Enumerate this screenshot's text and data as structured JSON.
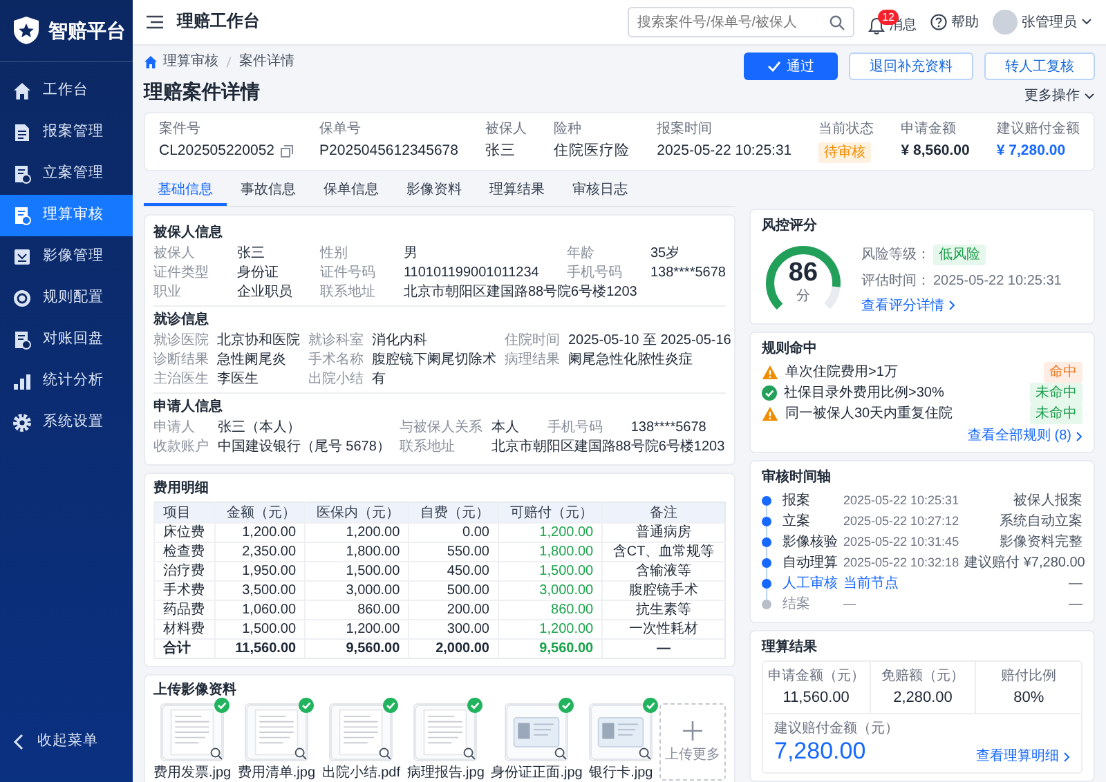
{
  "sidebar": {
    "logo": "智赔平台",
    "items": [
      {
        "label": "工作台",
        "selected": false
      },
      {
        "label": "报案管理",
        "selected": false
      },
      {
        "label": "立案管理",
        "selected": false
      },
      {
        "label": "理算审核",
        "selected": true
      },
      {
        "label": "影像管理",
        "selected": false
      },
      {
        "label": "规则配置",
        "selected": false
      },
      {
        "label": "对账回盘",
        "selected": false
      },
      {
        "label": "统计分析",
        "selected": false
      },
      {
        "label": "系统设置",
        "selected": false
      }
    ],
    "collapse": "收起菜单"
  },
  "topbar": {
    "title": "理赔工作台",
    "search": {
      "placeholder": "搜索案件号/保单号/被保人"
    },
    "notifications": {
      "label": "消息",
      "badge": "12"
    },
    "help": "帮助",
    "user": "张管理员"
  },
  "breadcrumb": [
    "理算审核",
    "案件详情"
  ],
  "page_title": "理赔案件详情",
  "actions": [
    {
      "label": "通过",
      "kind": "primary"
    },
    {
      "label": "退回补充资料",
      "kind": "default"
    },
    {
      "label": "转人工复核",
      "kind": "default"
    }
  ],
  "more_actions": "更多操作",
  "summary": [
    {
      "label": "案件号",
      "value": "CL202505220052",
      "kind": "copyable"
    },
    {
      "label": "保单号",
      "value": "P2025045612345678",
      "kind": "text"
    },
    {
      "label": "被保人",
      "value": "张三",
      "kind": "text"
    },
    {
      "label": "险种",
      "value": "住院医疗险",
      "kind": "text"
    },
    {
      "label": "报案时间",
      "value": "2025-05-22 10:25:31",
      "kind": "text"
    },
    {
      "label": "当前状态",
      "value": "待审核",
      "kind": "status"
    },
    {
      "label": "申请金额",
      "value": "¥ 8,560.00",
      "kind": "amount"
    },
    {
      "label": "建议赔付金额",
      "value": "¥ 7,280.00",
      "kind": "highlight"
    }
  ],
  "tabs": [
    {
      "label": "基础信息",
      "selected": true
    },
    {
      "label": "事故信息",
      "selected": false
    },
    {
      "label": "保单信息",
      "selected": false
    },
    {
      "label": "影像资料",
      "selected": false
    },
    {
      "label": "理算结果",
      "selected": false
    },
    {
      "label": "审核日志",
      "selected": false
    }
  ],
  "info_sections": [
    {
      "title": "被保人信息",
      "rows": [
        [
          {
            "label": "被保人",
            "value": "张三"
          },
          {
            "label": "性别",
            "value": "男"
          },
          {
            "label": "年龄",
            "value": "35岁"
          }
        ],
        [
          {
            "label": "证件类型",
            "value": "身份证"
          },
          {
            "label": "证件号码",
            "value": "110101199001011234"
          },
          {
            "label": "手机号码",
            "value": "138****5678"
          }
        ],
        [
          {
            "label": "职业",
            "value": "企业职员"
          },
          {
            "label": "联系地址",
            "value": "北京市朝阳区建国路88号院6号楼1203"
          }
        ]
      ]
    },
    {
      "title": "就诊信息",
      "rows": [
        [
          {
            "label": "就诊医院",
            "value": "北京协和医院"
          },
          {
            "label": "就诊科室",
            "value": "消化内科"
          },
          {
            "label": "住院时间",
            "value": "2025-05-10 至 2025-05-16"
          }
        ],
        [
          {
            "label": "诊断结果",
            "value": "急性阑尾炎"
          },
          {
            "label": "手术名称",
            "value": "腹腔镜下阑尾切除术"
          },
          {
            "label": "病理结果",
            "value": "阑尾急性化脓性炎症"
          }
        ],
        [
          {
            "label": "主治医生",
            "value": "李医生"
          },
          {
            "label": "出院小结",
            "value": "有"
          }
        ]
      ]
    },
    {
      "title": "申请人信息",
      "rows": [
        [
          {
            "label": "申请人",
            "value": "张三（本人）"
          },
          {
            "label": "与被保人关系",
            "value": "本人"
          },
          {
            "label": "手机号码",
            "value": "138****5678"
          }
        ],
        [
          {
            "label": "收款账户",
            "value": "中国建设银行（尾号 5678）"
          },
          {
            "label": "联系地址",
            "value": "北京市朝阳区建国路88号院6号楼1203"
          }
        ]
      ]
    }
  ],
  "expenses": {
    "title": "费用明细",
    "columns": [
      "项目",
      "金额（元）",
      "医保内（元）",
      "自费（元）",
      "可赔付（元）",
      "备注"
    ],
    "rows": [
      {
        "kind": "item",
        "cells": [
          "床位费",
          "1,200.00",
          "1,200.00",
          "0.00",
          "1,200.00",
          "普通病房"
        ]
      },
      {
        "kind": "item",
        "cells": [
          "检查费",
          "2,350.00",
          "1,800.00",
          "550.00",
          "1,800.00",
          "含CT、血常规等"
        ]
      },
      {
        "kind": "item",
        "cells": [
          "治疗费",
          "1,950.00",
          "1,500.00",
          "450.00",
          "1,500.00",
          "含输液等"
        ]
      },
      {
        "kind": "item",
        "cells": [
          "手术费",
          "3,500.00",
          "3,000.00",
          "500.00",
          "3,000.00",
          "腹腔镜手术"
        ]
      },
      {
        "kind": "item",
        "cells": [
          "药品费",
          "1,060.00",
          "860.00",
          "200.00",
          "860.00",
          "抗生素等"
        ]
      },
      {
        "kind": "item",
        "cells": [
          "材料费",
          "1,500.00",
          "1,200.00",
          "300.00",
          "1,200.00",
          "一次性耗材"
        ]
      },
      {
        "kind": "total",
        "cells": [
          "合计",
          "11,560.00",
          "9,560.00",
          "2,000.00",
          "9,560.00",
          "—"
        ]
      }
    ]
  },
  "uploads": {
    "title": "上传影像资料",
    "files": [
      {
        "name": "费用发票.jpg",
        "kind": "document",
        "verified": true
      },
      {
        "name": "费用清单.jpg",
        "kind": "document",
        "verified": true
      },
      {
        "name": "出院小结.pdf",
        "kind": "document",
        "verified": true
      },
      {
        "name": "病理报告.jpg",
        "kind": "document",
        "verified": true
      },
      {
        "name": "身份证正面.jpg",
        "kind": "card",
        "verified": true
      },
      {
        "name": "银行卡.jpg",
        "kind": "card",
        "verified": true
      }
    ],
    "add": "上传更多"
  },
  "risk": {
    "title": "风控评分",
    "score": "86",
    "unit": "分",
    "level": 0.86,
    "risk_label": "风险等级：",
    "risk_value": "低风险",
    "time_label": "评估时间：",
    "time_value": "2025-05-22 10:25:31",
    "link": "查看评分详情"
  },
  "rules": {
    "title": "规则命中",
    "items": [
      {
        "text": "单次住院费用>1万",
        "hit": true,
        "tag": "命中",
        "kind": "warning"
      },
      {
        "text": "社保目录外费用比例>30%",
        "hit": false,
        "tag": "未命中",
        "kind": "ok"
      },
      {
        "text": "同一被保人30天内重复住院",
        "hit": false,
        "tag": "未命中",
        "kind": "warning"
      }
    ],
    "link": "查看全部规则 (8)"
  },
  "timeline": {
    "title": "审核时间轴",
    "items": [
      {
        "step": "报案",
        "time": "2025-05-22 10:25:31",
        "note": "被保人报案",
        "kind": "done"
      },
      {
        "step": "立案",
        "time": "2025-05-22 10:27:12",
        "note": "系统自动立案",
        "kind": "done"
      },
      {
        "step": "影像核验",
        "time": "2025-05-22 10:31:45",
        "note": "影像资料完整",
        "kind": "done"
      },
      {
        "step": "自动理算",
        "time": "2025-05-22 10:32:18",
        "note": "建议赔付 ¥7,280.00",
        "kind": "done"
      },
      {
        "step": "人工审核",
        "time": "当前节点",
        "note": "—",
        "kind": "current"
      },
      {
        "step": "结案",
        "time": "—",
        "note": "—",
        "kind": "pending"
      }
    ]
  },
  "result": {
    "title": "理算结果",
    "cells": [
      {
        "label": "申请金额（元）",
        "value": "11,560.00"
      },
      {
        "label": "免赔额（元）",
        "value": "2,280.00"
      },
      {
        "label": "赔付比例",
        "value": "80%"
      }
    ],
    "suggested_label": "建议赔付金额（元）",
    "suggested_value": "7,280.00",
    "link": "查看理算明细"
  }
}
